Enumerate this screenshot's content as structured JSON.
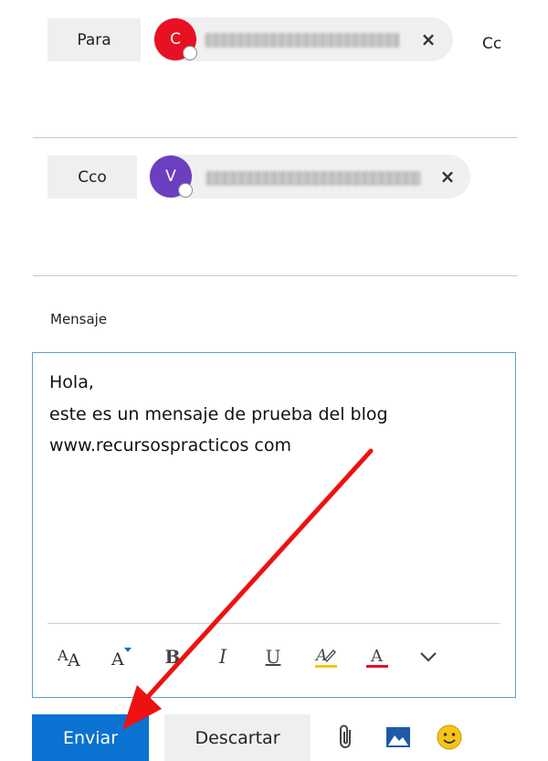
{
  "to_field": {
    "label": "Para",
    "recipient_initial": "C",
    "avatar_color": "#e81123",
    "remove_glyph": "×",
    "cc_label": "Cc"
  },
  "bcc_field": {
    "label": "Cco",
    "recipient_initial": "V",
    "avatar_color": "#6b3fbf",
    "remove_glyph": "×"
  },
  "message": {
    "label": "Mensaje",
    "body_lines": [
      "Hola,",
      "este es un mensaje de prueba del blog",
      "www.recursospracticos com"
    ]
  },
  "toolbar": {
    "items": [
      "font-size-icon",
      "grow-font-icon",
      "bold-icon",
      "italic-icon",
      "underline-icon",
      "highlight-icon",
      "font-color-icon",
      "more-options-icon"
    ],
    "bold_glyph": "B",
    "italic_glyph": "I",
    "underline_glyph": "U",
    "font_color_glyph": "A",
    "highlight_color": "#f2c811",
    "font_color": "#e81123"
  },
  "actions": {
    "send_label": "Enviar",
    "discard_label": "Descartar",
    "accent_color": "#0a72d0"
  },
  "annotation": {
    "arrow_color": "#ee1111"
  }
}
